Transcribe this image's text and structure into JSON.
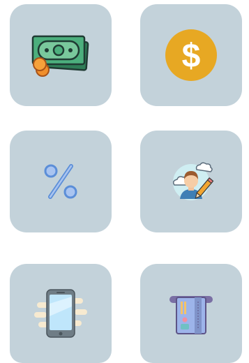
{
  "tiles": [
    {
      "icon": "cash-stack-icon"
    },
    {
      "icon": "dollar-coin-icon"
    },
    {
      "icon": "percent-icon"
    },
    {
      "icon": "user-edit-icon"
    },
    {
      "icon": "mobile-phone-icon"
    },
    {
      "icon": "card-terminal-icon"
    }
  ],
  "colors": {
    "tile_bg": "#c3d2da",
    "cash_green": "#3f9a6e",
    "coin_gold": "#e7a823",
    "percent_blue": "#6d9ee6"
  }
}
